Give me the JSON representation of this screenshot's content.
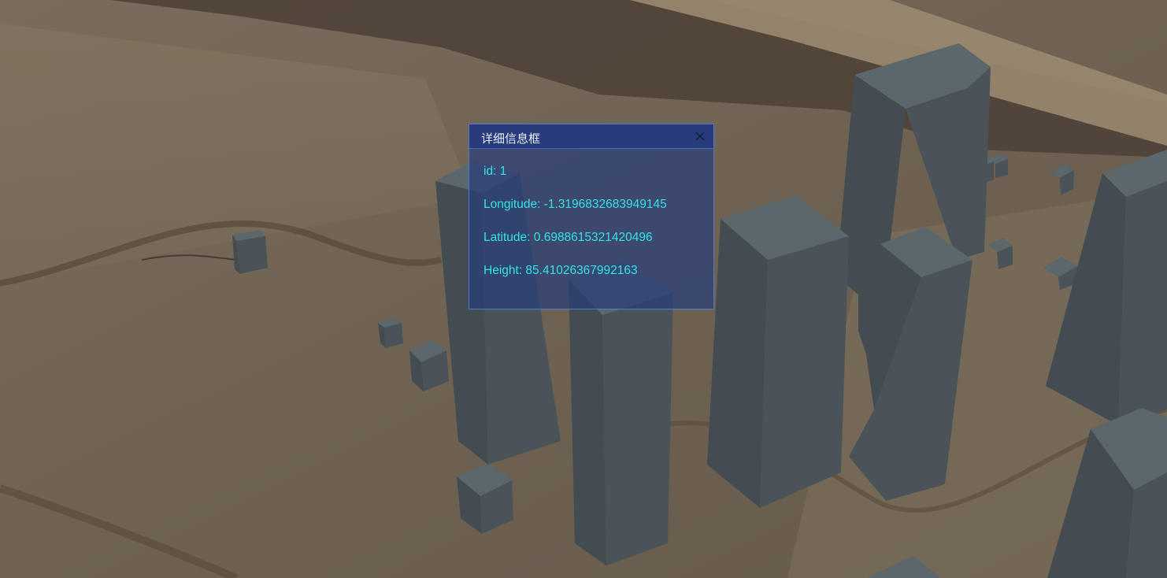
{
  "popup": {
    "title": "详细信息框",
    "close_icon": "close-icon",
    "rows": [
      {
        "label": "id",
        "value": "1",
        "text": "id: 1"
      },
      {
        "label": "Longitude",
        "value": "-1.3196832683949145",
        "text": "Longitude: -1.3196832683949145"
      },
      {
        "label": "Latitude",
        "value": "0.6988615321420496",
        "text": "Latitude: 0.6988615321420496"
      },
      {
        "label": "Height",
        "value": "85.41026367992163",
        "text": "Height: 85.41026367992163"
      }
    ]
  },
  "colors": {
    "ground": "#6e6254",
    "building_front": "#4a5458",
    "building_top": "#5c676b",
    "popup_bg": "#283e78",
    "popup_text": "#33e3e6"
  }
}
